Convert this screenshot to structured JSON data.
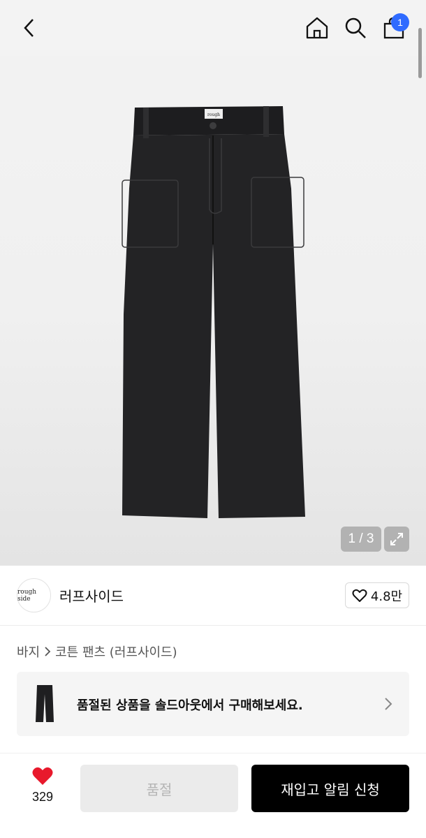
{
  "header": {
    "back_icon": "chevron-left-icon",
    "home_icon": "home-icon",
    "search_icon": "search-icon",
    "cart_icon": "shopping-bag-icon",
    "cart_count": "1",
    "badge_color": "#2f6bff"
  },
  "gallery": {
    "counter": "1 / 3",
    "expand_icon": "expand-icon",
    "image_label": "rough"
  },
  "brand": {
    "logo_text": "rough side",
    "name": "러프사이드",
    "heart_icon": "heart-outline-icon",
    "like_count": "4.8만"
  },
  "breadcrumb": {
    "category": "바지",
    "separator_icon": "chevron-right-icon",
    "product": "코튼 팬츠 (러프사이드)"
  },
  "soldout_banner": {
    "text": "품절된 상품을 솔드아웃에서 구매해보세요.",
    "chevron_icon": "chevron-right-icon"
  },
  "bottom_bar": {
    "heart_icon": "heart-filled-icon",
    "heart_color": "#e8192c",
    "wish_count": "329",
    "soldout_label": "품절",
    "restock_label": "재입고 알림 신청"
  }
}
